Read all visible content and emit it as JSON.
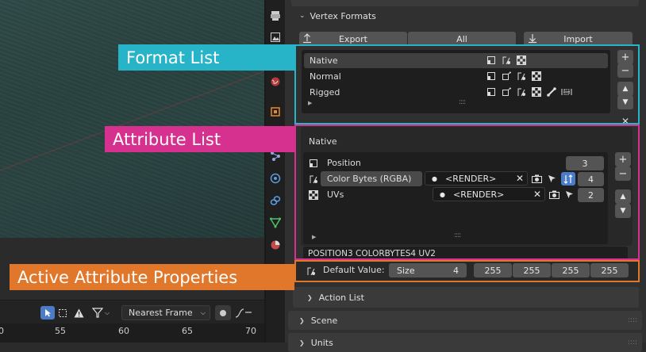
{
  "sections": {
    "vertex_formats": "Vertex Formats",
    "action_list": "Action List",
    "scene": "Scene",
    "units": "Units"
  },
  "toolbar": {
    "export": "Export",
    "all": "All",
    "import": "Import"
  },
  "format_list": {
    "items": [
      "Native",
      "Normal",
      "Rigged"
    ],
    "selected": "Native"
  },
  "attribute_list": {
    "title": "Native",
    "rows": [
      {
        "name": "Position",
        "value": "3"
      },
      {
        "name": "Color Bytes (RGBA)",
        "layer": "<RENDER>",
        "value": "4"
      },
      {
        "name": "UVs",
        "layer": "<RENDER>",
        "value": "2"
      }
    ],
    "summary": "POSITION3 COLORBYTES4 UV2"
  },
  "active_attribute": {
    "default_label": "Default Value:",
    "size_label": "Size",
    "size_value": "4",
    "values": [
      "255",
      "255",
      "255",
      "255"
    ]
  },
  "viewport_header": {
    "frame_mode": "Nearest Frame"
  },
  "timeline": {
    "ticks": [
      "0",
      "55",
      "60",
      "65",
      "70"
    ]
  },
  "annotations": {
    "format_list": "Format List",
    "attribute_list": "Attribute List",
    "active_attribute": "Active Attribute Properties"
  },
  "colors": {
    "format_list": "#27b4c8",
    "attribute_list": "#d6318e",
    "active_attribute": "#e0772a",
    "selected_icon": "#4a7cc7"
  }
}
